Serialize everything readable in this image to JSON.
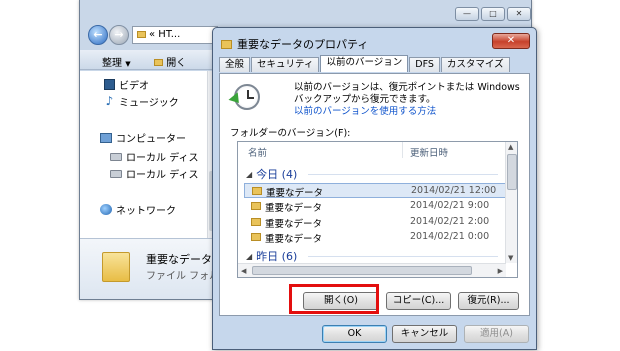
{
  "explorer": {
    "address_text": "« HT...",
    "toolbar": {
      "organize_label": "整理",
      "open_label": "開く"
    },
    "nav_items": [
      {
        "label": "ビデオ",
        "icon": "video-icon"
      },
      {
        "label": "ミュージック",
        "icon": "music-icon"
      },
      {
        "label": "コンピューター",
        "icon": "computer-icon"
      },
      {
        "label": "ローカル ディス",
        "icon": "disk-icon"
      },
      {
        "label": "ローカル ディス",
        "icon": "disk-icon"
      },
      {
        "label": "ネットワーク",
        "icon": "network-icon"
      }
    ],
    "details": {
      "name": "重要なデータ",
      "type": "ファイル フォル"
    }
  },
  "dialog": {
    "title": "重要なデータのプロパティ",
    "close_glyph": "✕",
    "tabs": [
      "全般",
      "セキュリティ",
      "以前のバージョン",
      "DFS",
      "カスタマイズ"
    ],
    "active_tab": "以前のバージョン",
    "intro_text": "以前のバージョンは、復元ポイントまたは Windows バックアップから復元できます。",
    "intro_link": "以前のバージョンを使用する方法",
    "versions_label": "フォルダーのバージョン(F):",
    "columns": {
      "name": "名前",
      "date": "更新日時"
    },
    "groups": [
      {
        "label": "今日 (4)",
        "rows": [
          {
            "name": "重要なデータ",
            "date": "2014/02/21 12:00",
            "selected": true
          },
          {
            "name": "重要なデータ",
            "date": "2014/02/21 9:00",
            "selected": false
          },
          {
            "name": "重要なデータ",
            "date": "2014/02/21 2:00",
            "selected": false
          },
          {
            "name": "重要なデータ",
            "date": "2014/02/21 0:00",
            "selected": false
          }
        ]
      },
      {
        "label": "昨日 (6)",
        "rows": []
      }
    ],
    "buttons": {
      "open": "開く(O)",
      "copy": "コピー(C)...",
      "restore": "復元(R)...",
      "ok": "OK",
      "cancel": "キャンセル",
      "apply": "適用(A)"
    }
  },
  "colors": {
    "highlight": "#e30e0e",
    "link": "#1155cc",
    "group_text": "#1a3e9a",
    "selection": "#dde8f6"
  }
}
